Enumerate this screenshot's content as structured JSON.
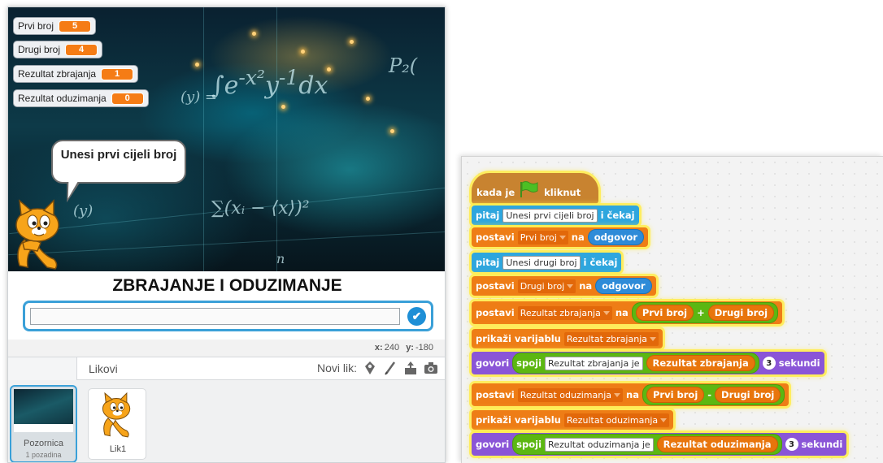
{
  "stage": {
    "monitors": [
      {
        "label": "Prvi broj",
        "value": "5"
      },
      {
        "label": "Drugi broj",
        "value": "4"
      },
      {
        "label": "Rezultat zbrajanja",
        "value": "1"
      },
      {
        "label": "Rezultat oduzimanja",
        "value": "0"
      }
    ],
    "speech": "Unesi prvi cijeli broj",
    "ask_prompt": "ZBRAJANJE I ODUZIMANJE",
    "coords": {
      "x_label": "x:",
      "x": "240",
      "y_label": "y:",
      "y": "-180"
    }
  },
  "sprites_pane": {
    "title": "Likovi",
    "new_sprite_label": "Novi lik:",
    "stage_label": "Pozornica",
    "stage_sub": "1 pozadina",
    "sprite_name": "Lik1"
  },
  "colors": {
    "events": "#c88330",
    "sensing": "#2ea6de",
    "data": "#ee7d16",
    "looks": "#8a55d7",
    "operators": "#5cb712",
    "glow": "#ffec50"
  },
  "script": {
    "hat": {
      "pre": "kada je",
      "post": "kliknut",
      "icon": "green-flag-icon"
    },
    "b1": {
      "kw": "pitaj",
      "text": "Unesi prvi cijeli broj",
      "kw2": "i čekaj"
    },
    "b2": {
      "kw": "postavi",
      "var": "Prvi broj",
      "kw2": "na",
      "val": "odgovor"
    },
    "b3": {
      "kw": "pitaj",
      "text": "Unesi drugi broj",
      "kw2": "i čekaj"
    },
    "b4": {
      "kw": "postavi",
      "var": "Drugi broj",
      "kw2": "na",
      "val": "odgovor"
    },
    "b5": {
      "kw": "postavi",
      "var": "Rezultat zbrajanja",
      "kw2": "na",
      "a": "Prvi broj",
      "op": "+",
      "b": "Drugi broj"
    },
    "b6": {
      "kw": "prikaži varijablu",
      "var": "Rezultat zbrajanja"
    },
    "b7": {
      "kw": "govori",
      "join": "spoji",
      "text": "Rezultat zbrajanja je",
      "var": "Rezultat zbrajanja",
      "secs": "3",
      "unit": "sekundi"
    },
    "b8": {
      "kw": "postavi",
      "var": "Rezultat oduzimanja",
      "kw2": "na",
      "a": "Prvi broj",
      "op": "-",
      "b": "Drugi broj"
    },
    "b9": {
      "kw": "prikaži varijablu",
      "var": "Rezultat oduzimanja"
    },
    "b10": {
      "kw": "govori",
      "join": "spoji",
      "text": "Rezultat oduzimanja je",
      "var": "Rezultat oduzimanja",
      "secs": "3",
      "unit": "sekundi"
    }
  }
}
